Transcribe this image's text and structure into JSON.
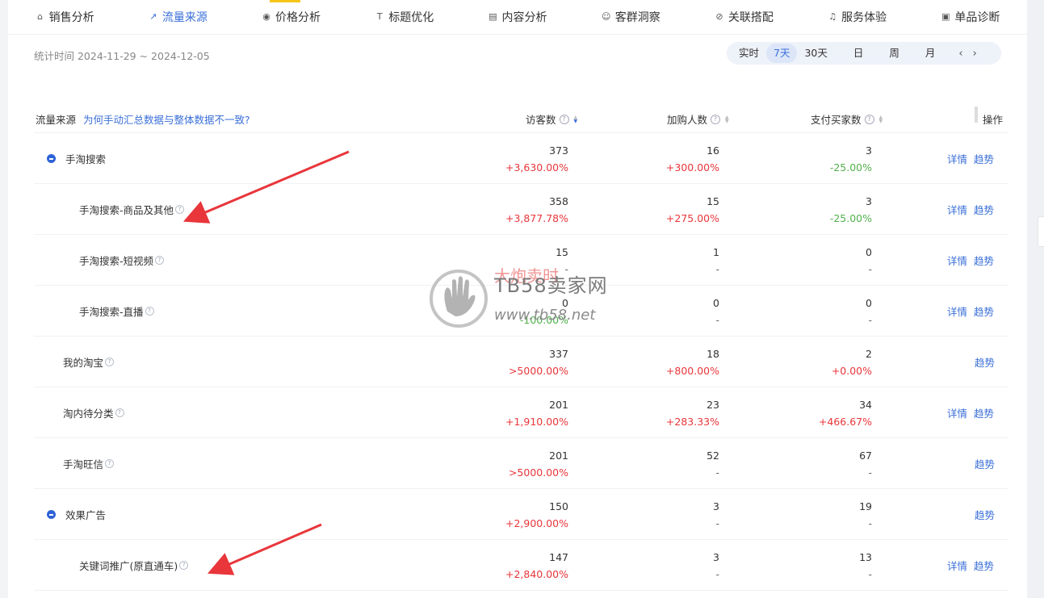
{
  "tabs": [
    {
      "label": "销售分析",
      "icon": "home-icon"
    },
    {
      "label": "流量来源",
      "icon": "trend-chart-icon"
    },
    {
      "label": "价格分析",
      "icon": "price-tag-icon"
    },
    {
      "label": "标题优化",
      "icon": "title-icon"
    },
    {
      "label": "内容分析",
      "icon": "document-icon"
    },
    {
      "label": "客群洞察",
      "icon": "users-icon"
    },
    {
      "label": "关联搭配",
      "icon": "link-icon"
    },
    {
      "label": "服务体验",
      "icon": "headset-icon"
    },
    {
      "label": "单品诊断",
      "icon": "diagnosis-icon"
    }
  ],
  "active_tab": 1,
  "date_range": "统计时间 2024-11-29 ~ 2024-12-05",
  "periods": [
    "实时",
    "7天",
    "30天",
    "日",
    "周",
    "月"
  ],
  "active_period": 1,
  "table": {
    "header_source": "流量来源",
    "header_link": "为何手动汇总数据与整体数据不一致?",
    "col_visitors": "访客数",
    "col_cart": "加购人数",
    "col_buyers": "支付买家数",
    "col_ops": "操作",
    "detail_label": "详情",
    "trend_label": "趋势",
    "rows": [
      {
        "name": "手淘搜索",
        "collapsible": true,
        "indent": 0,
        "visitors": "373",
        "visitors_pct": "+3,630.00%",
        "cart": "16",
        "cart_pct": "+300.00%",
        "buyers": "3",
        "buyers_pct": "-25.00%",
        "detail": true
      },
      {
        "name": "手淘搜索-商品及其他",
        "collapsible": false,
        "indent": 2,
        "visitors": "358",
        "visitors_pct": "+3,877.78%",
        "cart": "15",
        "cart_pct": "+275.00%",
        "buyers": "3",
        "buyers_pct": "-25.00%",
        "detail": true
      },
      {
        "name": "手淘搜索-短视频",
        "collapsible": false,
        "indent": 2,
        "visitors": "15",
        "visitors_pct": "-",
        "cart": "1",
        "cart_pct": "-",
        "buyers": "0",
        "buyers_pct": "-",
        "detail": true
      },
      {
        "name": "手淘搜索-直播",
        "collapsible": false,
        "indent": 2,
        "visitors": "0",
        "visitors_pct": "-100.00%",
        "cart": "0",
        "cart_pct": "-",
        "buyers": "0",
        "buyers_pct": "-",
        "detail": true
      },
      {
        "name": "我的淘宝",
        "collapsible": false,
        "indent": 1,
        "visitors": "337",
        "visitors_pct": ">5000.00%",
        "cart": "18",
        "cart_pct": "+800.00%",
        "buyers": "2",
        "buyers_pct": "+0.00%",
        "detail": false
      },
      {
        "name": "淘内待分类",
        "collapsible": false,
        "indent": 1,
        "visitors": "201",
        "visitors_pct": "+1,910.00%",
        "cart": "23",
        "cart_pct": "+283.33%",
        "buyers": "34",
        "buyers_pct": "+466.67%",
        "detail": true
      },
      {
        "name": "手淘旺信",
        "collapsible": false,
        "indent": 1,
        "visitors": "201",
        "visitors_pct": ">5000.00%",
        "cart": "52",
        "cart_pct": "-",
        "buyers": "67",
        "buyers_pct": "-",
        "detail": false
      },
      {
        "name": "效果广告",
        "collapsible": true,
        "indent": 0,
        "visitors": "150",
        "visitors_pct": "+2,900.00%",
        "cart": "3",
        "cart_pct": "-",
        "buyers": "19",
        "buyers_pct": "-",
        "detail": false
      },
      {
        "name": "关键词推广(原直通车)",
        "collapsible": false,
        "indent": 2,
        "visitors": "147",
        "visitors_pct": "+2,840.00%",
        "cart": "3",
        "cart_pct": "-",
        "buyers": "13",
        "buyers_pct": "-",
        "detail": true
      }
    ]
  },
  "watermark": {
    "title": "TB58卖家网",
    "url": "www.tb58.net",
    "red_text": "大炮卖时"
  },
  "colors": {
    "accent": "#3a6fd8",
    "up": "#e8363b",
    "down": "#52b04c",
    "arrow": "#e8363b",
    "tab_mark": "#f5c518"
  }
}
